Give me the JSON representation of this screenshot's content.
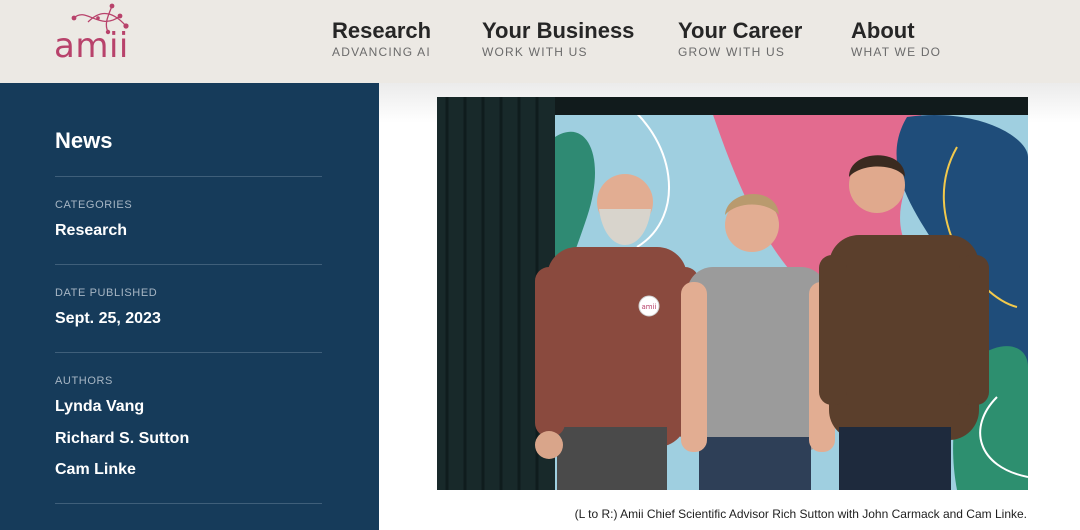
{
  "header": {
    "logo_text": "amii",
    "nav": [
      {
        "title": "Research",
        "subtitle": "ADVANCING AI"
      },
      {
        "title": "Your Business",
        "subtitle": "WORK WITH US"
      },
      {
        "title": "Your Career",
        "subtitle": "GROW WITH US"
      },
      {
        "title": "About",
        "subtitle": "WHAT WE DO"
      }
    ]
  },
  "sidebar": {
    "title": "News",
    "categories_label": "CATEGORIES",
    "category": "Research",
    "date_label": "DATE PUBLISHED",
    "date": "Sept. 25, 2023",
    "authors_label": "AUTHORS",
    "authors": [
      "Lynda Vang",
      "Richard S. Sutton",
      "Cam Linke"
    ]
  },
  "photo": {
    "badge_text": "amii",
    "caption": "(L to R:) Amii Chief Scientific Advisor Rich Sutton with John Carmack and Cam Linke."
  },
  "colors": {
    "brand": "#b8426b",
    "sidebar": "#163b5a",
    "header": "#ece9e4"
  }
}
